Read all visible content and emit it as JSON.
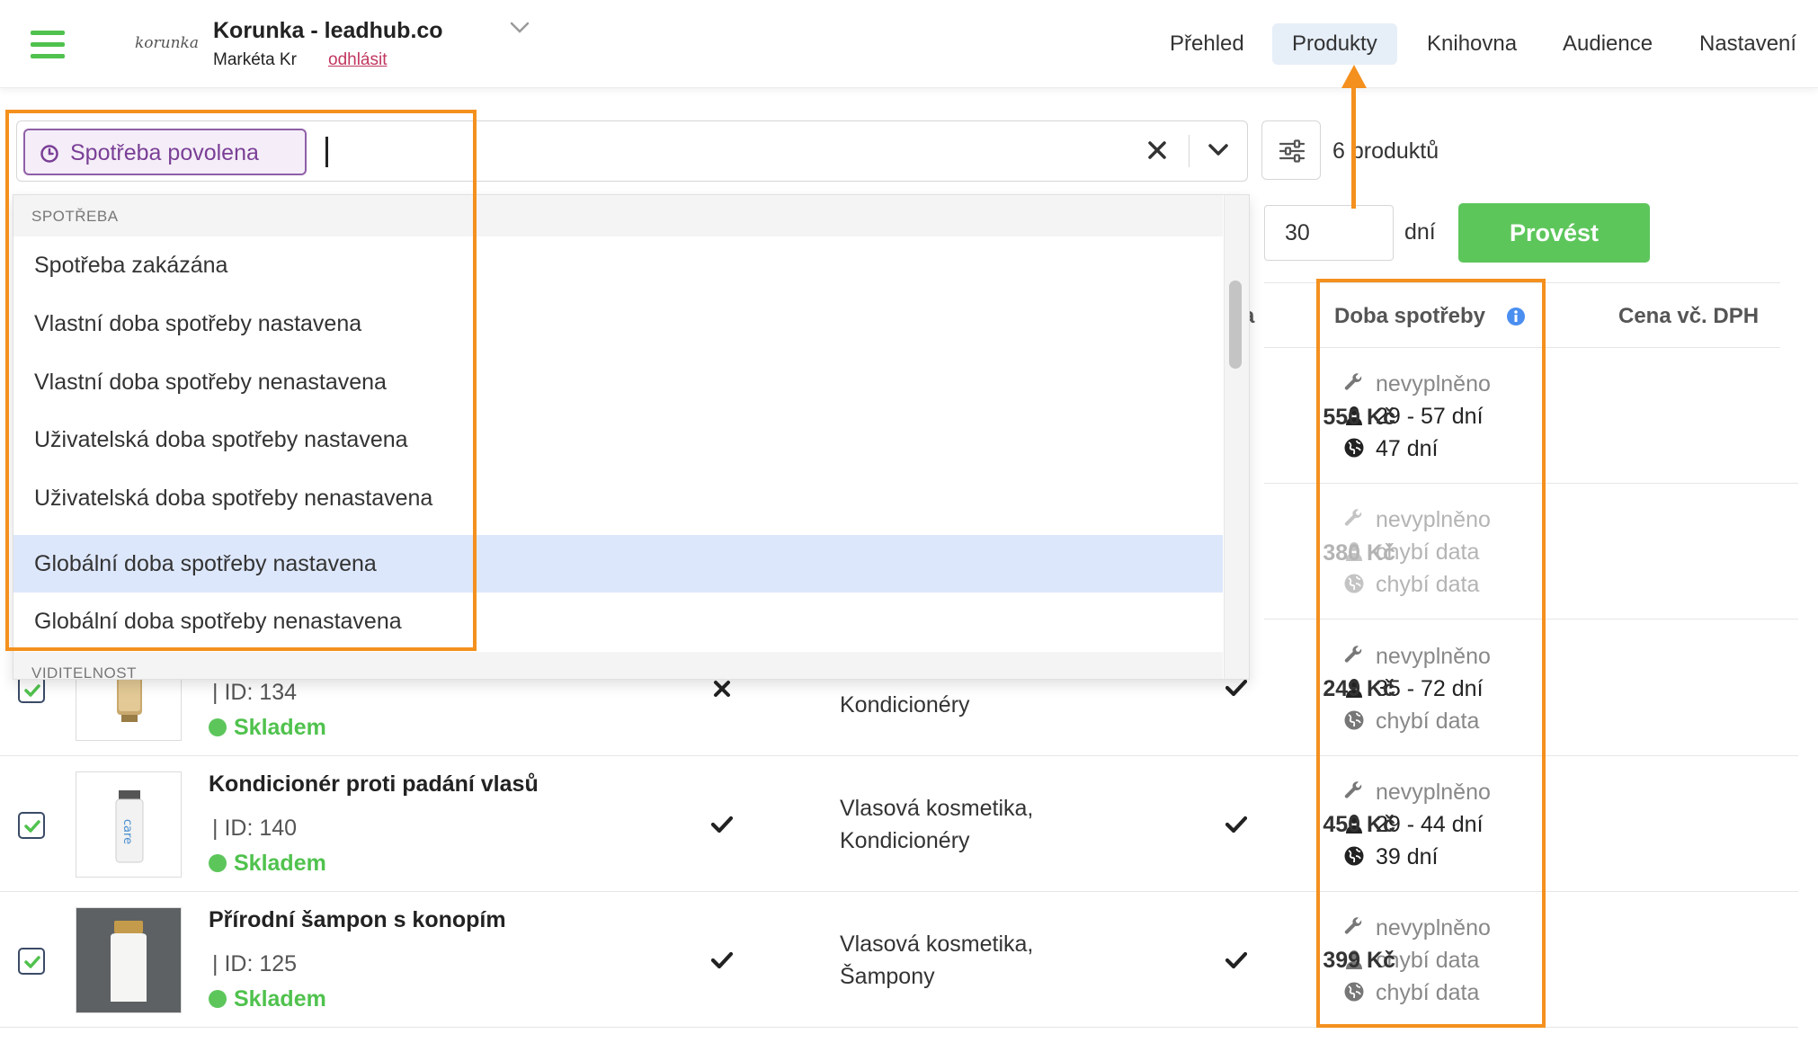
{
  "header": {
    "logo_text": "korunka",
    "account_title": "Korunka - leadhub.co",
    "user_name": "Markéta Kr",
    "logout_label": "odhlásit",
    "nav": [
      {
        "label": "Přehled",
        "active": false
      },
      {
        "label": "Produkty",
        "active": true
      },
      {
        "label": "Knihovna",
        "active": false
      },
      {
        "label": "Audience",
        "active": false
      },
      {
        "label": "Nastavení",
        "active": false
      }
    ]
  },
  "search": {
    "chip_label": "Spotřeba povolena",
    "chip_icon": "clock-icon",
    "input_value": "",
    "clear_icon": "close-icon",
    "toggle_icon": "chevron-down-icon"
  },
  "toolbar": {
    "filter_icon": "sliders-icon",
    "product_count": "6 produktů",
    "days_value": "30",
    "days_unit": "dní",
    "run_label": "Provést"
  },
  "dropdown": {
    "groups": [
      {
        "label": "SPOTŘEBA",
        "items": [
          {
            "label": "Spotřeba zakázána",
            "highlighted": false
          },
          {
            "label": "Vlastní doba spotřeby nastavena",
            "highlighted": false
          },
          {
            "label": "Vlastní doba spotřeby nenastavena",
            "highlighted": false
          },
          {
            "label": "Uživatelská doba spotřeby nastavena",
            "highlighted": false
          },
          {
            "label": "Uživatelská doba spotřeby nenastavena",
            "highlighted": false
          },
          {
            "label": "Globální doba spotřeby nastavena",
            "highlighted": true
          },
          {
            "label": "Globální doba spotřeby nenastavena",
            "highlighted": false
          }
        ]
      },
      {
        "label": "VIDITELNOST",
        "items": []
      }
    ]
  },
  "table": {
    "headers": {
      "partial": "eba",
      "lifetime": "Doba spotřeby",
      "price": "Cena vč. DPH"
    },
    "lifetime_info_icon": "info-icon",
    "colors": {
      "stock": "#50c24e",
      "accent_orange": "#f4901e",
      "chip_purple": "#7a3f96"
    },
    "rows": [
      {
        "name": "",
        "id": "",
        "stock": "",
        "categories": [],
        "lifetime": [
          {
            "icon": "wrench-icon",
            "text": "nevyplněno",
            "tone": "gray"
          },
          {
            "icon": "user-icon",
            "text": "29 - 57 dní",
            "tone": "dark"
          },
          {
            "icon": "globe-icon",
            "text": "47 dní",
            "tone": "dark"
          }
        ],
        "price": "550 Kč",
        "price_muted": false
      },
      {
        "name": "",
        "id": "",
        "stock": "",
        "categories": [],
        "lifetime": [
          {
            "icon": "wrench-icon",
            "text": "nevyplněno",
            "tone": "light"
          },
          {
            "icon": "user-icon",
            "text": "chybí data",
            "tone": "light"
          },
          {
            "icon": "globe-icon",
            "text": "chybí data",
            "tone": "light"
          }
        ],
        "price": "380 Kč",
        "price_muted": true
      },
      {
        "name": "",
        "id": "| ID: 134",
        "stock": "Skladem",
        "categories": [
          "Kondicionéry"
        ],
        "lifetime": [
          {
            "icon": "wrench-icon",
            "text": "nevyplněno",
            "tone": "gray"
          },
          {
            "icon": "user-icon",
            "text": "35 - 72 dní",
            "tone": "dark"
          },
          {
            "icon": "globe-icon",
            "text": "chybí data",
            "tone": "gray"
          }
        ],
        "price": "249 Kč",
        "price_muted": false
      },
      {
        "name": "Kondicionér proti padání vlasů",
        "id": "| ID: 140",
        "stock": "Skladem",
        "categories": [
          "Vlasová kosmetika,",
          "Kondicionéry"
        ],
        "lifetime": [
          {
            "icon": "wrench-icon",
            "text": "nevyplněno",
            "tone": "gray"
          },
          {
            "icon": "user-icon",
            "text": "29 - 44 dní",
            "tone": "dark"
          },
          {
            "icon": "globe-icon",
            "text": "39 dní",
            "tone": "dark"
          }
        ],
        "price": "450 Kč",
        "price_muted": false
      },
      {
        "name": "Přírodní šampon s konopím",
        "id": "| ID: 125",
        "stock": "Skladem",
        "categories": [
          "Vlasová kosmetika,",
          "Šampony"
        ],
        "lifetime": [
          {
            "icon": "wrench-icon",
            "text": "nevyplněno",
            "tone": "gray"
          },
          {
            "icon": "user-icon",
            "text": "chybí data",
            "tone": "gray"
          },
          {
            "icon": "globe-icon",
            "text": "chybí data",
            "tone": "gray"
          }
        ],
        "price": "399 Kč",
        "price_muted": false
      }
    ]
  }
}
